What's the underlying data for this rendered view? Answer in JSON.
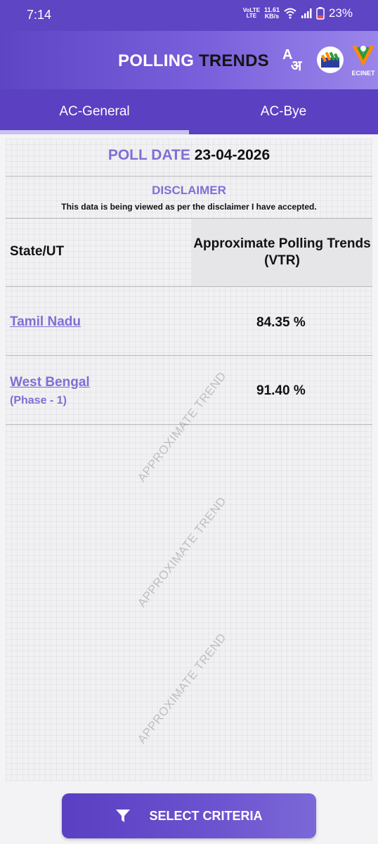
{
  "status_bar": {
    "time": "7:14",
    "network": "LTE",
    "volte": "VoLTE",
    "speed_value": "11.61",
    "speed_unit": "KB/s",
    "battery": "23%"
  },
  "header": {
    "title_part1": "POLLING",
    "title_part2": "TRENDS",
    "language_icon": "language-toggle-icon",
    "logo_icon": "eci-logo-icon",
    "ecinet_label": "ECINET"
  },
  "tabs": [
    {
      "label": "AC-General",
      "active": true
    },
    {
      "label": "AC-Bye",
      "active": false
    }
  ],
  "poll": {
    "date_label": "POLL DATE",
    "date_value": "23-04-2026"
  },
  "disclaimer": {
    "title": "DISCLAIMER",
    "text": "This data is being viewed as per the disclaimer I have accepted."
  },
  "table": {
    "headers": [
      "State/UT",
      "Approximate Polling Trends (VTR)"
    ],
    "rows": [
      {
        "state": "Tamil Nadu",
        "sub": "",
        "value": "84.35 %"
      },
      {
        "state": "West Bengal",
        "sub": "(Phase - 1)",
        "value": "91.40 %"
      }
    ]
  },
  "watermark": "APPROXIMATE TREND",
  "footer": {
    "button_label": "SELECT CRITERIA",
    "button_icon": "filter-icon"
  },
  "colors": {
    "primary": "#5b40c2",
    "accent_text": "#7f6fd4"
  }
}
